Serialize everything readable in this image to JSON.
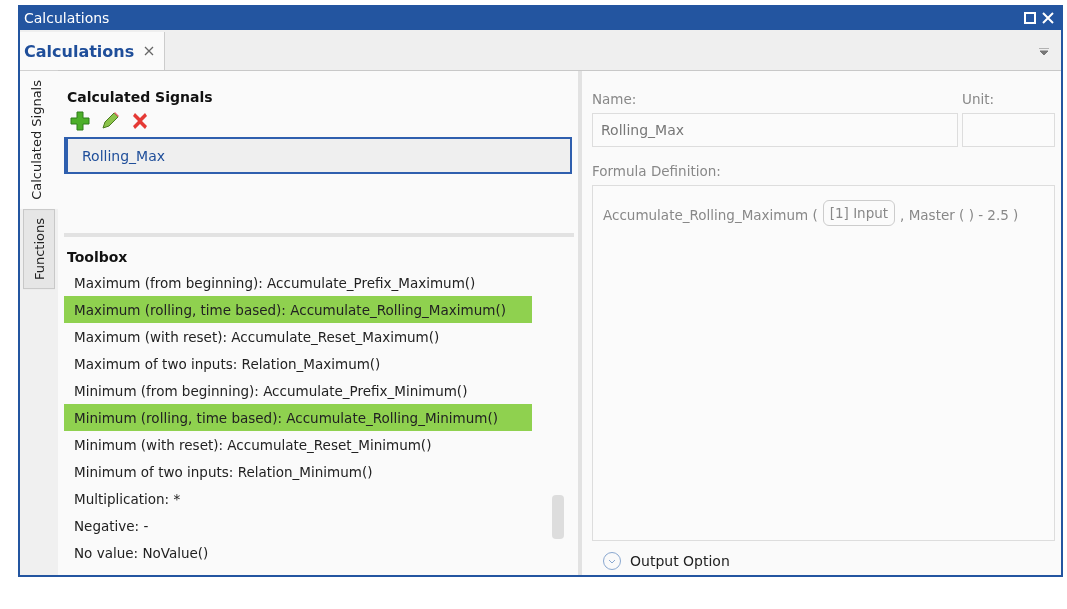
{
  "window": {
    "title": "Calculations"
  },
  "doc_tabs": [
    {
      "label": "Calculations",
      "selected": true
    }
  ],
  "side_tabs": [
    {
      "label": "Calculated Signals",
      "selected": true
    },
    {
      "label": "Functions",
      "selected": false
    }
  ],
  "signals": {
    "title": "Calculated Signals",
    "items": [
      {
        "label": "Rolling_Max",
        "selected": true
      }
    ]
  },
  "toolbox": {
    "title": "Toolbox",
    "items": [
      {
        "label": "Maximum (from beginning):",
        "function": "Accumulate_Prefix_Maximum()",
        "highlighted": false
      },
      {
        "label": "Maximum (rolling, time based):",
        "function": "Accumulate_Rolling_Maximum()",
        "highlighted": true
      },
      {
        "label": "Maximum (with reset):",
        "function": "Accumulate_Reset_Maximum()",
        "highlighted": false
      },
      {
        "label": "Maximum of two inputs:",
        "function": "Relation_Maximum()",
        "highlighted": false
      },
      {
        "label": "Minimum (from beginning):",
        "function": "Accumulate_Prefix_Minimum()",
        "highlighted": false
      },
      {
        "label": "Minimum (rolling, time based):",
        "function": "Accumulate_Rolling_Minimum()",
        "highlighted": true
      },
      {
        "label": "Minimum (with reset):",
        "function": "Accumulate_Reset_Minimum()",
        "highlighted": false
      },
      {
        "label": "Minimum of two inputs:",
        "function": "Relation_Minimum()",
        "highlighted": false
      },
      {
        "label": "Multiplication:",
        "function": "*",
        "highlighted": false
      },
      {
        "label": "Negative:",
        "function": "-",
        "highlighted": false
      },
      {
        "label": "No value:",
        "function": "NoValue()",
        "highlighted": false
      }
    ]
  },
  "details": {
    "name_label": "Name:",
    "name_value": "Rolling_Max",
    "unit_label": "Unit:",
    "formula_label": "Formula Definition:",
    "formula": [
      {
        "kind": "text",
        "text": "Accumulate_Rolling_Maximum ("
      },
      {
        "kind": "chip",
        "text": "[1] Input"
      },
      {
        "kind": "text",
        "text": ", Master ( )  - 2.5 )"
      }
    ],
    "output_options": "Output Option"
  }
}
